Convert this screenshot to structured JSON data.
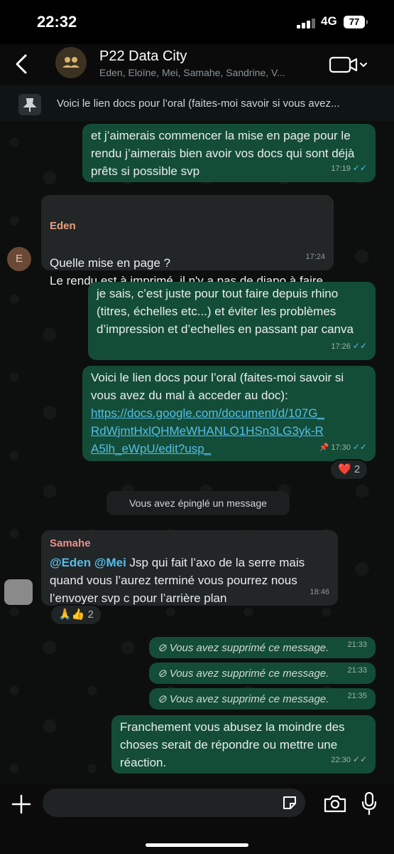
{
  "status_bar": {
    "time": "22:32",
    "network": "4G",
    "battery": "77"
  },
  "header": {
    "title": "P22 Data City",
    "subtitle": "Eden, Eloïne, Mei, Samahe, Sandrine, V..."
  },
  "pinned": {
    "text": "Voici le lien docs pour l’oral (faites-moi savoir si vous avez..."
  },
  "messages": [
    {
      "text": "et j’aimerais commencer la mise en page pour le rendu j’aimerais bien avoir vos docs qui sont déjà prêts si possible svp",
      "time": "17:19"
    },
    {
      "sender": "Eden",
      "text": "Quelle mise en page ?\nLe rendu est à imprimé, il n'y a pas de diapo à faire",
      "time": "17:24",
      "avatar_letter": "E"
    },
    {
      "text": "je sais, c’est juste pour tout faire depuis rhino (titres, échelles etc...) et éviter les problèmes d’impression et d’echelles en passant par canva",
      "time": "17:26"
    },
    {
      "text": "Voici le lien docs pour l’oral (faites-moi savoir si vous avez du mal à acceder au doc):",
      "link": "https://docs.google.com/document/d/107G_RdWjmtHxlQHMeWHANLO1HSn3LG3yk-RA5lh_eWpU/edit?usp_",
      "time": "17:30",
      "reaction": "❤️",
      "reaction_count": "2"
    },
    {
      "system": "Vous avez épinglé un message"
    },
    {
      "sender": "Samahe",
      "mention1": "@Eden",
      "mention2": "@Mei",
      "text": " Jsp qui fait l’axo de la serre mais quand vous l’aurez terminé vous pourrez nous l’envoyer svp c pour l’arrière plan",
      "time": "18:46",
      "reaction": "🙏👍",
      "reaction_count": "2"
    },
    {
      "deleted": "Vous avez supprimé ce message.",
      "time": "21:33"
    },
    {
      "deleted": "Vous avez supprimé ce message.",
      "time": "21:33"
    },
    {
      "deleted": "Vous avez supprimé ce message.",
      "time": "21:35"
    },
    {
      "text": "Franchement vous abusez la moindre des choses serait de répondre ou mettre une réaction.",
      "time": "22:30"
    }
  ],
  "colors": {
    "outgoing": "#144d37",
    "incoming": "#222626",
    "link": "#53bdeb",
    "eden_name": "#e7a07b",
    "samahe_name": "#f08c8c"
  },
  "icons": [
    "back-icon",
    "group-avatar-icon",
    "video-call-icon",
    "pin-icon",
    "plus-icon",
    "sticker-icon",
    "camera-icon",
    "mic-icon"
  ]
}
